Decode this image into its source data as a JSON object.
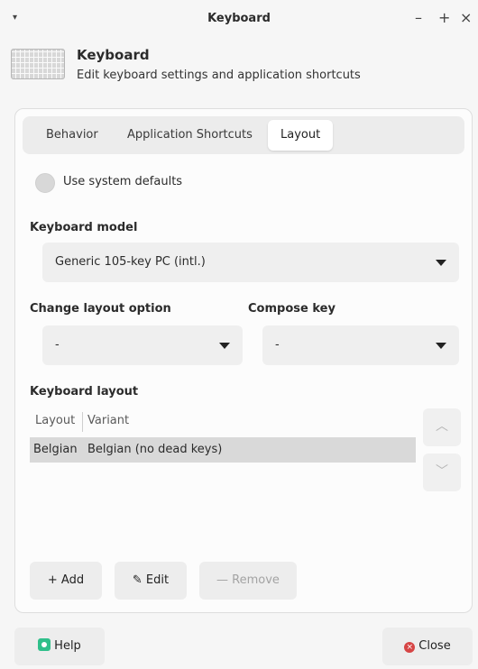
{
  "window": {
    "title": "Keyboard",
    "menu_glyph": "▾",
    "minimize_glyph": "–",
    "maximize_glyph": "+",
    "close_glyph": "×"
  },
  "header": {
    "title": "Keyboard",
    "subtitle": "Edit keyboard settings and application shortcuts"
  },
  "tabs": [
    {
      "label": "Behavior",
      "active": false
    },
    {
      "label": "Application Shortcuts",
      "active": false
    },
    {
      "label": "Layout",
      "active": true
    }
  ],
  "defaults_toggle": {
    "label": "Use system defaults",
    "checked": false
  },
  "keyboard_model": {
    "label": "Keyboard model",
    "value": "Generic 105-key PC (intl.)"
  },
  "change_layout": {
    "label": "Change layout option",
    "value": "-"
  },
  "compose_key": {
    "label": "Compose key",
    "value": "-"
  },
  "layout_table": {
    "label": "Keyboard layout",
    "columns": [
      "Layout",
      "Variant"
    ],
    "rows": [
      {
        "layout": "Belgian",
        "variant": "Belgian (no dead keys)",
        "selected": true
      }
    ]
  },
  "side_buttons": {
    "up_glyph": "︿",
    "down_glyph": "﹀"
  },
  "actions": {
    "add_label": "+ Add",
    "edit_label": "Edit",
    "remove_label": "— Remove"
  },
  "footer": {
    "help_label": "Help",
    "close_label": "Close"
  },
  "colors": {
    "help_icon": "#2fbf8a",
    "close_icon": "#d64545",
    "selected_row": "#d9d9d9"
  }
}
